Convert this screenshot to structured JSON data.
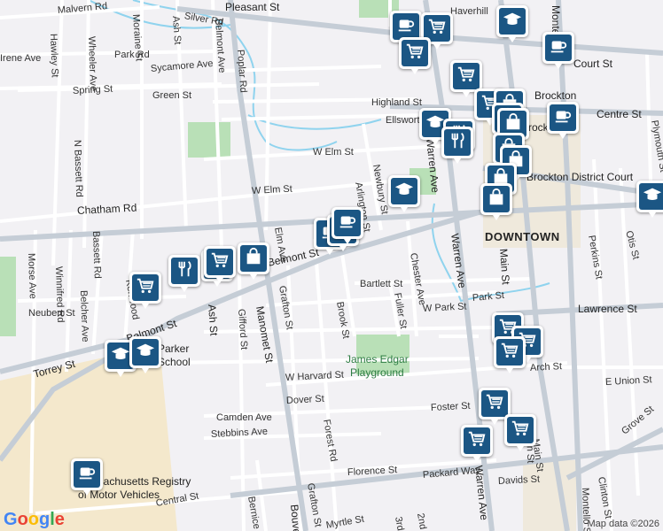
{
  "map": {
    "streets": [
      {
        "name": "Malvern Rd"
      },
      {
        "name": "Silver Rd"
      },
      {
        "name": "Pleasant St"
      },
      {
        "name": "Hawley St"
      },
      {
        "name": "Wheeler Ave"
      },
      {
        "name": "Park Rd"
      },
      {
        "name": "Sycamore Ave"
      },
      {
        "name": "Spring St"
      },
      {
        "name": "Green St"
      },
      {
        "name": "Highland St"
      },
      {
        "name": "Ellsworth St"
      },
      {
        "name": "W Elm St"
      },
      {
        "name": "W Elm St"
      },
      {
        "name": "Chatham Rd"
      },
      {
        "name": "N Bassett Rd"
      },
      {
        "name": "Bassett Rd"
      },
      {
        "name": "Morse Ave"
      },
      {
        "name": "Winnifred Rd"
      },
      {
        "name": "Belcher Ave"
      },
      {
        "name": "Neubert St"
      },
      {
        "name": "Belmont St"
      },
      {
        "name": "Belmont St"
      },
      {
        "name": "Torrey St"
      },
      {
        "name": "Manomet St"
      },
      {
        "name": "Elm Ave"
      },
      {
        "name": "Grafton St"
      },
      {
        "name": "Brook St"
      },
      {
        "name": "Arlington St"
      },
      {
        "name": "Newbury St"
      },
      {
        "name": "Chester Ave"
      },
      {
        "name": "Fuller St"
      },
      {
        "name": "Bartlett St"
      },
      {
        "name": "W Park St"
      },
      {
        "name": "Park St"
      },
      {
        "name": "Warren Ave"
      },
      {
        "name": "Main St"
      },
      {
        "name": "Montello St"
      },
      {
        "name": "Lawrence St"
      },
      {
        "name": "W Harvard St"
      },
      {
        "name": "Dover St"
      },
      {
        "name": "Camden Ave"
      },
      {
        "name": "Stebbins Ave"
      },
      {
        "name": "Forest Rd"
      },
      {
        "name": "Florence St"
      },
      {
        "name": "Packard Way"
      },
      {
        "name": "Davids St"
      },
      {
        "name": "Grafton St"
      },
      {
        "name": "Central St"
      },
      {
        "name": "Bouve"
      },
      {
        "name": "Ash St"
      },
      {
        "name": "Gifford St"
      },
      {
        "name": "Arch St"
      },
      {
        "name": "E Union St"
      },
      {
        "name": "Foster St"
      },
      {
        "name": "Grove St"
      },
      {
        "name": "Clinton St"
      },
      {
        "name": "Court St"
      },
      {
        "name": "Centre St"
      },
      {
        "name": "Haverhill"
      },
      {
        "name": "Perkins St"
      },
      {
        "name": "Otis St"
      },
      {
        "name": "Plymouth St"
      },
      {
        "name": "Poplar Rd"
      },
      {
        "name": "Belmont Ave"
      },
      {
        "name": "Moraine St"
      },
      {
        "name": "Ash St"
      },
      {
        "name": "Kenwood"
      },
      {
        "name": "Irene Ave"
      },
      {
        "name": "Warren Ave"
      },
      {
        "name": "Warren Ave"
      },
      {
        "name": "Main St"
      },
      {
        "name": "Montello St"
      },
      {
        "name": "Bernice Ave"
      },
      {
        "name": "2nd St"
      },
      {
        "name": "3rd St"
      },
      {
        "name": "Myrtle St"
      },
      {
        "name": "Main St"
      }
    ],
    "places": [
      {
        "name": "DOWNTOWN"
      },
      {
        "name": "Brockton District Court"
      },
      {
        "name": "Brockton"
      },
      {
        "name": "James Edgar"
      },
      {
        "name": "Playground"
      },
      {
        "name": "Parker"
      },
      {
        "name": "School"
      },
      {
        "name": "Massachusetts Registry"
      },
      {
        "name": "of Motor Vehicles"
      },
      {
        "name": "Brock"
      }
    ],
    "pins": [
      {
        "icon": "cup-icon"
      },
      {
        "icon": "cart-icon"
      },
      {
        "icon": "cart-icon"
      },
      {
        "icon": "graduation-cap-icon"
      },
      {
        "icon": "cup-icon"
      },
      {
        "icon": "cart-icon"
      },
      {
        "icon": "cart-icon"
      },
      {
        "icon": "bag-icon"
      },
      {
        "icon": "graduation-cap-icon"
      },
      {
        "icon": "fork-knife-icon"
      },
      {
        "icon": "bag-icon"
      },
      {
        "icon": "cup-icon"
      },
      {
        "icon": "fork-knife-icon"
      },
      {
        "icon": "bag-icon"
      },
      {
        "icon": "bag-icon"
      },
      {
        "icon": "bag-icon"
      },
      {
        "icon": "graduation-cap-icon"
      },
      {
        "icon": "graduation-cap-icon"
      },
      {
        "icon": "cup-icon"
      },
      {
        "icon": "cup-icon"
      },
      {
        "icon": "cup-icon"
      },
      {
        "icon": "bag-icon"
      },
      {
        "icon": "bag-icon"
      },
      {
        "icon": "fork-knife-icon"
      },
      {
        "icon": "fork-knife-icon"
      },
      {
        "icon": "cart-icon"
      },
      {
        "icon": "cart-icon"
      },
      {
        "icon": "bag-icon"
      },
      {
        "icon": "cart-icon"
      },
      {
        "icon": "cart-icon"
      },
      {
        "icon": "graduation-cap-icon"
      },
      {
        "icon": "graduation-cap-icon"
      },
      {
        "icon": "cart-icon"
      },
      {
        "icon": "cart-icon"
      },
      {
        "icon": "cart-icon"
      },
      {
        "icon": "cart-icon"
      },
      {
        "icon": "cup-icon"
      }
    ],
    "brand": "Google",
    "attribution": "Map data ©2026",
    "colors": {
      "road": "#ffffff",
      "road_major": "#c5cdd6",
      "park": "#b9e0b7",
      "school_area": "#f4e8cc",
      "water": "#8fd3ee",
      "pin": "#1b5684",
      "background": "#f2f1f4"
    }
  }
}
